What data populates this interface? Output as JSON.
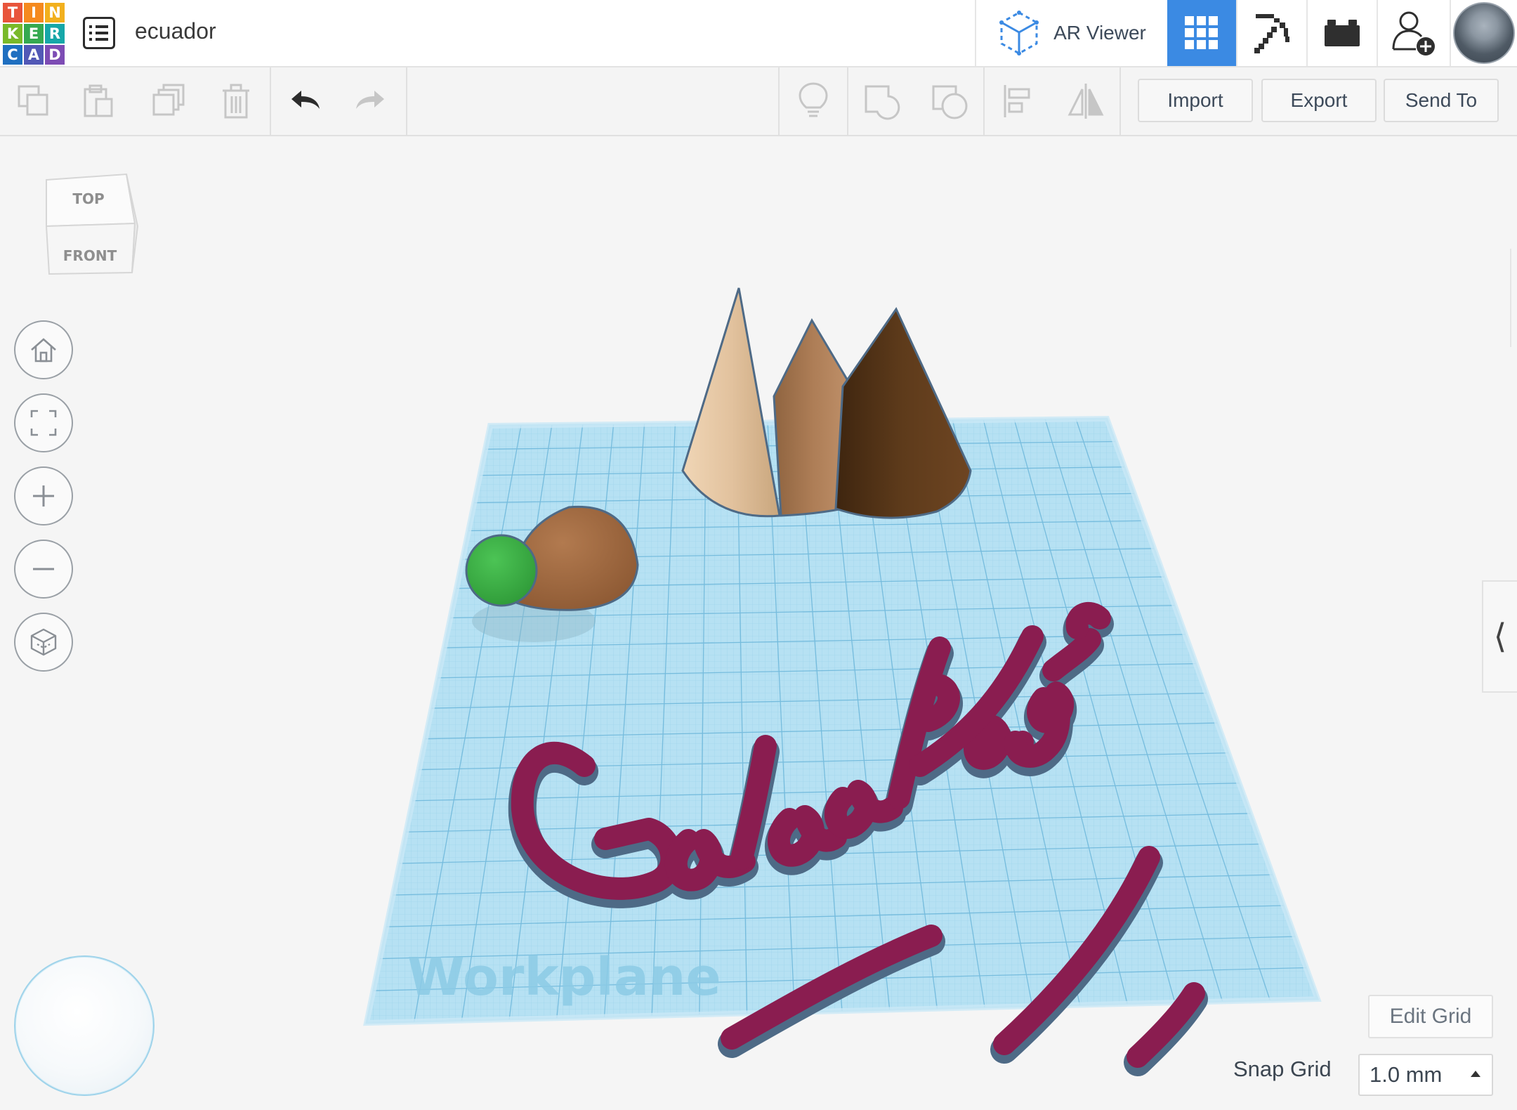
{
  "app": {
    "logo_letters": [
      "T",
      "I",
      "N",
      "K",
      "E",
      "R",
      "C",
      "A",
      "D"
    ],
    "logo_colors": [
      "#e8543b",
      "#f58a1f",
      "#f2b01e",
      "#79b929",
      "#35a950",
      "#16a7a8",
      "#1f6fc0",
      "#5258b6",
      "#7d4cb4"
    ]
  },
  "header": {
    "design_title": "ecuador",
    "ar_viewer_label": "AR Viewer",
    "active_view": "3D Design",
    "accent_color": "#3b8ae3"
  },
  "toolbar": {
    "tools": [
      "copy-icon",
      "paste-icon",
      "duplicate-icon",
      "delete-icon",
      "undo-icon",
      "redo-icon",
      "lightbulb-icon",
      "group-icon",
      "ungroup-icon",
      "align-icon",
      "mirror-icon"
    ],
    "import_label": "Import",
    "export_label": "Export",
    "send_to_label": "Send To"
  },
  "viewcube": {
    "top_label": "TOP",
    "front_label": "FRONT"
  },
  "nav": {
    "buttons": [
      "home-view-icon",
      "fit-view-icon",
      "zoom-in-icon",
      "zoom-out-icon",
      "perspective-icon"
    ]
  },
  "scene": {
    "workplane_label": "Workplane",
    "workplane_color": "#a7dcf1",
    "text_object": "Galapagos",
    "text_color": "#8a1d50",
    "cone_colors": [
      "#e3c3a0",
      "#a97a54",
      "#5c3a1a"
    ],
    "dome_color": "#a36c44",
    "sphere_color": "#3dad45"
  },
  "grid": {
    "edit_grid_label": "Edit Grid",
    "snap_grid_label": "Snap Grid",
    "snap_grid_value": "1.0 mm"
  }
}
